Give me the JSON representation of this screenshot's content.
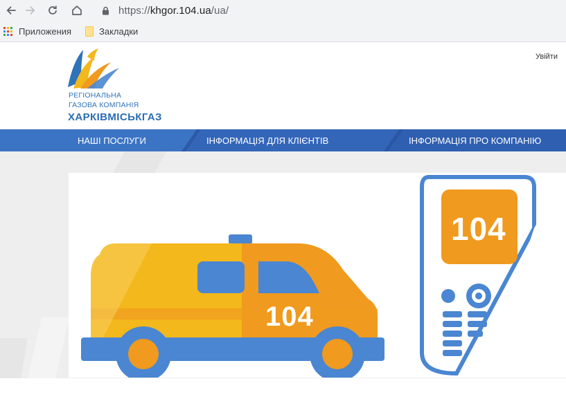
{
  "browser": {
    "url_scheme": "https://",
    "url_host": "khgor.104.ua",
    "url_path": "/ua/",
    "bookmarks": [
      {
        "label": "Приложения"
      },
      {
        "label": "Закладки"
      }
    ]
  },
  "header": {
    "brand_line1": "РЕГІОНАЛЬНА",
    "brand_line2": "ГАЗОВА КОМПАНІЯ",
    "brand_name": "ХАРКІВМІСЬКГАЗ",
    "login_label": "Увійти"
  },
  "menu": {
    "items": [
      {
        "label": "НАШІ ПОСЛУГИ"
      },
      {
        "label": "ІНФОРМАЦІЯ ДЛЯ КЛІЄНТІВ"
      },
      {
        "label": "ІНФОРМАЦІЯ ПРО КОМПАНІЮ"
      }
    ]
  },
  "banner": {
    "van_number": "104",
    "phone_number": "104"
  },
  "colors": {
    "brand_blue": "#2f73b9",
    "menu_blue": "#3565b8",
    "van_yellow": "#f3b81b",
    "van_orange": "#f09a1f",
    "accent_blue": "#4a86d1"
  }
}
